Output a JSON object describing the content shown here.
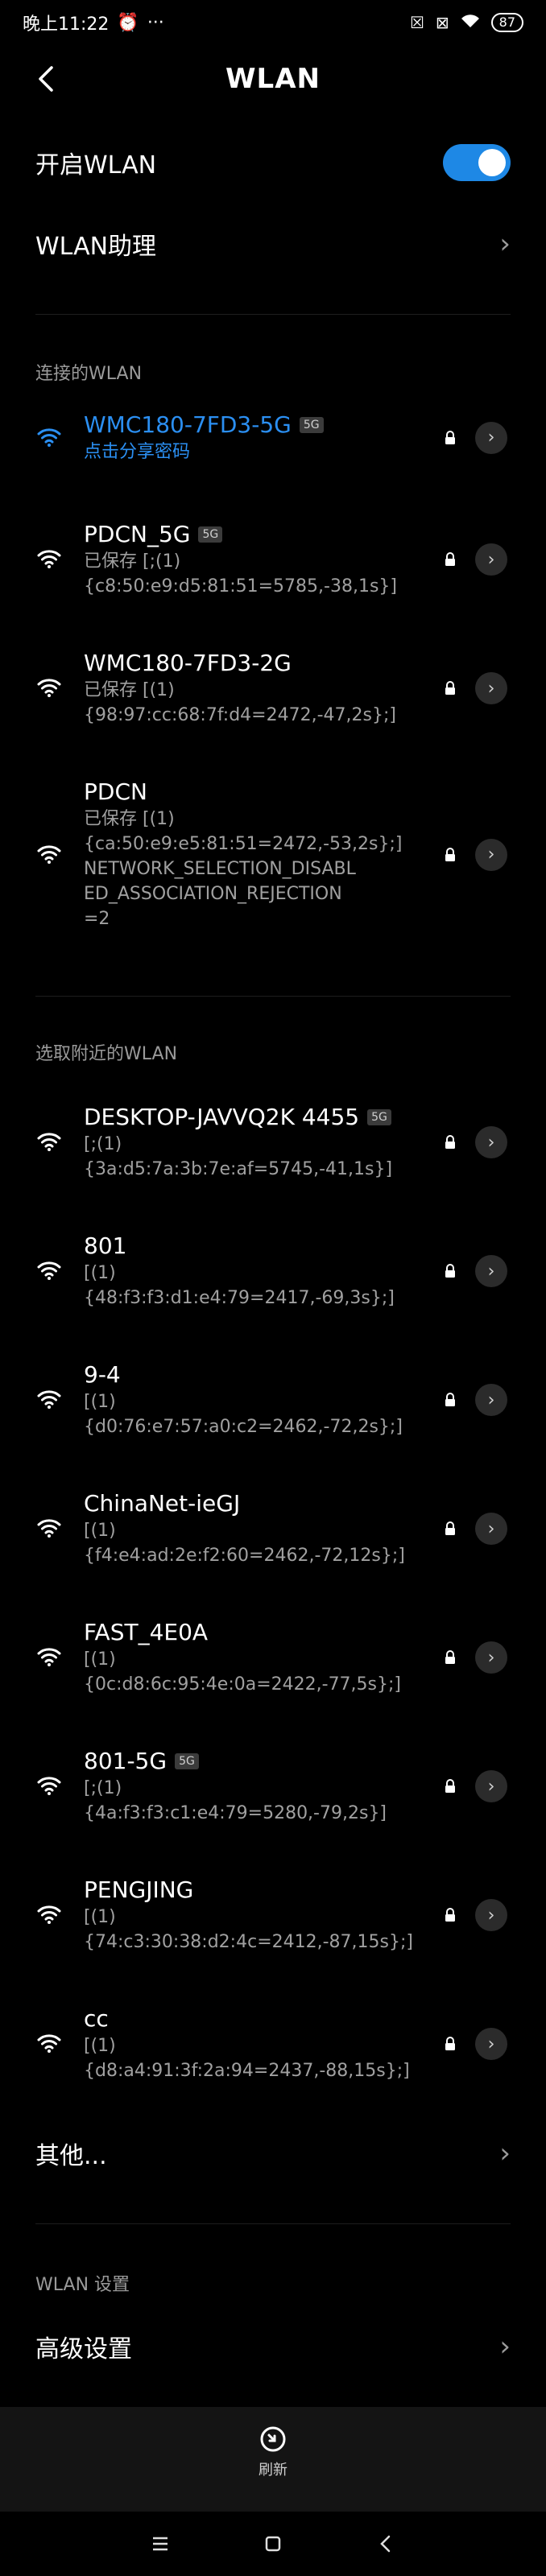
{
  "status_bar": {
    "time": "晚上11:22",
    "more": "···",
    "battery": "87"
  },
  "header": {
    "title": "WLAN"
  },
  "toggle_row": {
    "label": "开启WLAN",
    "enabled": true
  },
  "assistant_row": {
    "label": "WLAN助理"
  },
  "connected_section": {
    "header": "连接的WLAN",
    "items": [
      {
        "name": "WMC180-7FD3-5G",
        "badge": "5G",
        "lines": [
          "点击分享密码"
        ],
        "connected": true
      }
    ]
  },
  "saved_items": [
    {
      "name": "PDCN_5G",
      "badge": "5G",
      "lines": [
        "已保存 [;(1)",
        "{c8:50:e9:d5:81:51=5785,-38,1s}]"
      ]
    },
    {
      "name": "WMC180-7FD3-2G",
      "badge": "",
      "lines": [
        "已保存 [(1)",
        "{98:97:cc:68:7f:d4=2472,-47,2s};]"
      ]
    },
    {
      "name": "PDCN",
      "badge": "",
      "lines": [
        "已保存 [(1)",
        "{ca:50:e9:e5:81:51=2472,-53,2s};]",
        "NETWORK_SELECTION_DISABL",
        "ED_ASSOCIATION_REJECTION",
        "=2"
      ]
    }
  ],
  "nearby_section": {
    "header": "选取附近的WLAN",
    "items": [
      {
        "name": "DESKTOP-JAVVQ2K 4455",
        "badge": "5G",
        "lines": [
          "[;(1)",
          "{3a:d5:7a:3b:7e:af=5745,-41,1s}]"
        ]
      },
      {
        "name": "801",
        "badge": "",
        "lines": [
          "[(1)",
          "{48:f3:f3:d1:e4:79=2417,-69,3s};]"
        ]
      },
      {
        "name": "9-4",
        "badge": "",
        "lines": [
          "[(1)",
          "{d0:76:e7:57:a0:c2=2462,-72,2s};]"
        ]
      },
      {
        "name": "ChinaNet-ieGJ",
        "badge": "",
        "lines": [
          "[(1)",
          "{f4:e4:ad:2e:f2:60=2462,-72,12s};]"
        ]
      },
      {
        "name": "FAST_4E0A",
        "badge": "",
        "lines": [
          "[(1)",
          "{0c:d8:6c:95:4e:0a=2422,-77,5s};]"
        ]
      },
      {
        "name": "801-5G",
        "badge": "5G",
        "lines": [
          "[;(1)",
          "{4a:f3:f3:c1:e4:79=5280,-79,2s}]"
        ]
      },
      {
        "name": "PENGJING",
        "badge": "",
        "lines": [
          "[(1)",
          "{74:c3:30:38:d2:4c=2412,-87,15s};]"
        ]
      },
      {
        "name": "cc",
        "badge": "",
        "lines": [
          "[(1)",
          "{d8:a4:91:3f:2a:94=2437,-88,15s};]"
        ]
      }
    ]
  },
  "other_row": {
    "label": "其他..."
  },
  "settings_section": {
    "header": "WLAN 设置"
  },
  "advanced_row": {
    "label": "高级设置"
  },
  "bottom": {
    "refresh_label": "刷新"
  },
  "colors": {
    "accent": "#2b8ff2",
    "toggle": "#1e88e5",
    "background": "#000000"
  }
}
